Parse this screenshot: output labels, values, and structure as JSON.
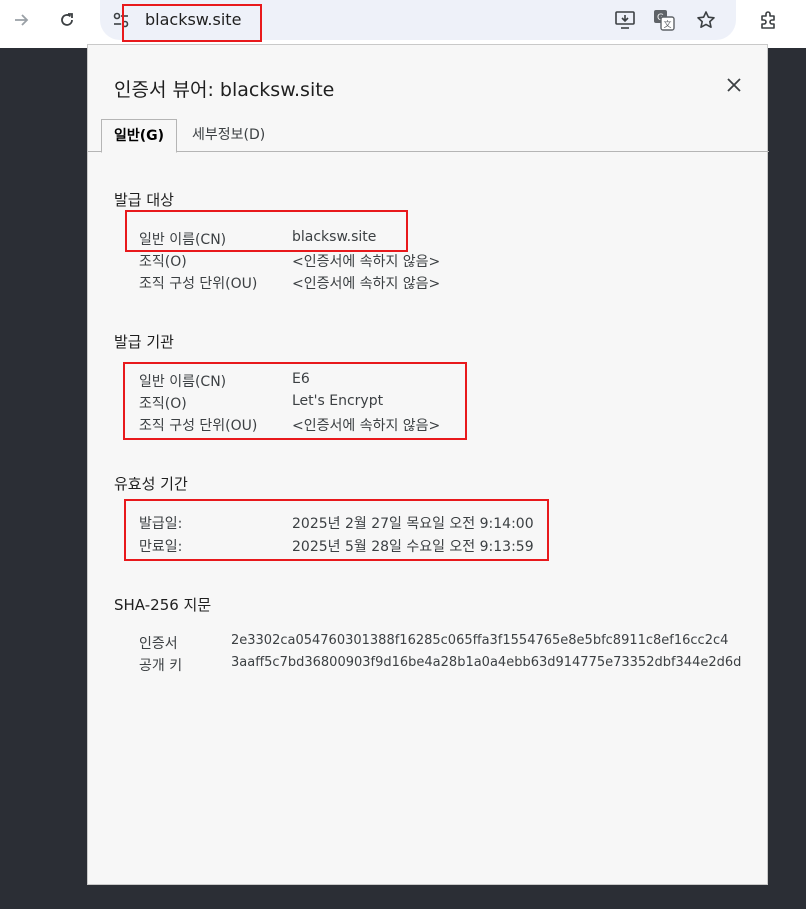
{
  "browser": {
    "url": "blacksw.site"
  },
  "dialog": {
    "title": "인증서 뷰어: blacksw.site",
    "tabs": [
      {
        "label": "일반(G)"
      },
      {
        "label": "세부정보(D)"
      }
    ],
    "issued_to": {
      "title": "발급 대상",
      "rows": [
        {
          "label": "일반 이름(CN)",
          "value": "blacksw.site"
        },
        {
          "label": "조직(O)",
          "value": "<인증서에 속하지 않음>"
        },
        {
          "label": "조직 구성 단위(OU)",
          "value": "<인증서에 속하지 않음>"
        }
      ]
    },
    "issued_by": {
      "title": "발급 기관",
      "rows": [
        {
          "label": "일반 이름(CN)",
          "value": "E6"
        },
        {
          "label": "조직(O)",
          "value": "Let's Encrypt"
        },
        {
          "label": "조직 구성 단위(OU)",
          "value": "<인증서에 속하지 않음>"
        }
      ]
    },
    "validity": {
      "title": "유효성 기간",
      "rows": [
        {
          "label": "발급일:",
          "value": "2025년 2월 27일 목요일 오전 9:14:00"
        },
        {
          "label": "만료일:",
          "value": "2025년 5월 28일 수요일 오전 9:13:59"
        }
      ]
    },
    "fingerprints": {
      "title": "SHA-256 지문",
      "rows": [
        {
          "label": "인증서",
          "value": "2e3302ca054760301388f16285c065ffa3f1554765e8e5bfc8911c8ef16cc2c4"
        },
        {
          "label": "공개 키",
          "value": "3aaff5c7bd36800903f9d16be4a28b1a0a4ebb63d914775e73352dbf344e2d6d"
        }
      ]
    }
  },
  "icons": [
    "forward-icon",
    "reload-icon",
    "site-info-icon",
    "install-app-icon",
    "translate-icon",
    "bookmark-star-icon",
    "extensions-icon",
    "close-icon"
  ],
  "colors": {
    "highlight": "#e8191c",
    "omnibox": "#eef1f9",
    "backdrop": "#2b2e35"
  }
}
